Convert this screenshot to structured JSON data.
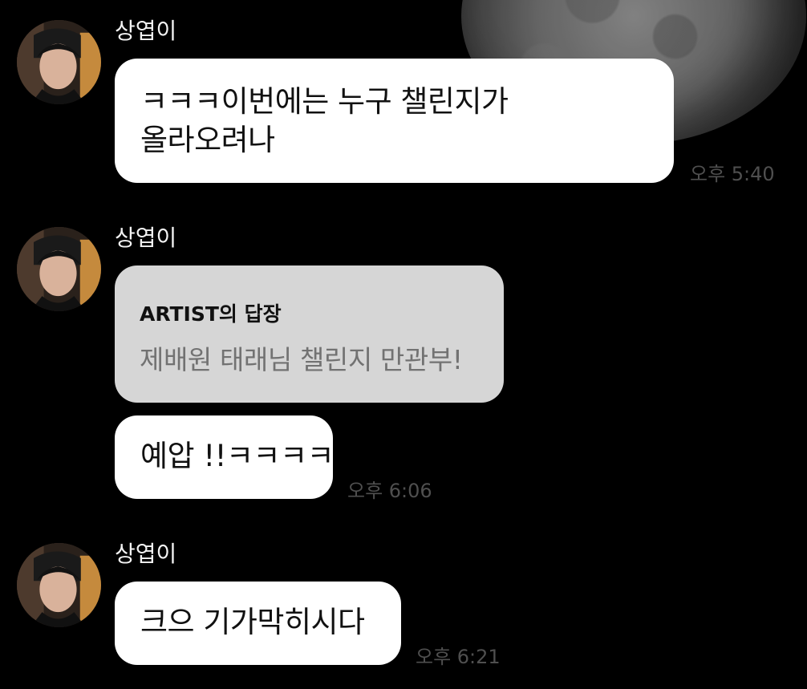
{
  "messages": [
    {
      "sender": "상엽이",
      "text_lines": [
        "ㅋㅋㅋ이번에는 누구 챌린지가",
        "올라오려나"
      ],
      "time": "오후 5:40"
    },
    {
      "sender": "상엽이",
      "reply_card": {
        "title": "ARTIST의 답장",
        "body": "제배원 태래님 챌린지 만관부!"
      },
      "text": "예압 !!ㅋㅋㅋㅋ",
      "time": "오후 6:06"
    },
    {
      "sender": "상엽이",
      "text": "크으 기가막히시다",
      "time": "오후 6:21"
    }
  ],
  "colors": {
    "background": "#000000",
    "bubble": "#ffffff",
    "reply_card": "#d6d6d6",
    "sender_name": "#f2f2f2",
    "time": "#4f4f4f"
  },
  "icons": {
    "avatar": "avatar",
    "background_moon": "moon"
  }
}
